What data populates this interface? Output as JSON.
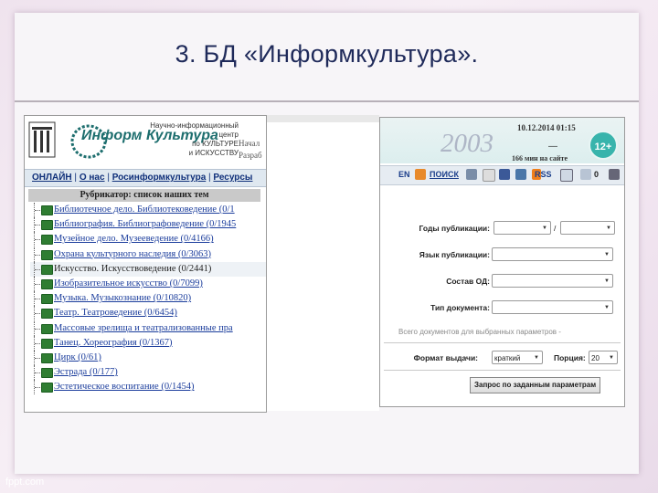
{
  "slide": {
    "title": "3. БД  «Информкультура».",
    "watermark": "fppt.com"
  },
  "site1": {
    "logo_text": "Информ Культура",
    "center_lines": [
      "Научно-информационный",
      "центр",
      "по КУЛЬТУРЕ",
      "и ИСКУССТВУ"
    ],
    "side_lines": [
      "Начал",
      "Разраб"
    ],
    "nav": [
      {
        "label": "ОНЛАЙН"
      },
      {
        "label": "О нас"
      },
      {
        "label": "Росинформкультура"
      },
      {
        "label": "Ресурсы"
      }
    ],
    "rubricator_title": "Рубрикатор: список наших тем",
    "items": [
      {
        "label": "Библиотечное дело. Библиотековедение (0/1"
      },
      {
        "label": "Библиография. Библиографоведение (0/1945"
      },
      {
        "label": "Музейное дело. Музееведение (0/4166)"
      },
      {
        "label": "Охрана культурного наследия (0/3063)"
      },
      {
        "label": "Искусство. Искусствоведение (0/2441)"
      },
      {
        "label": "Изобразительное искусство (0/7099)"
      },
      {
        "label": "Музыка. Музыкознание (0/10820)"
      },
      {
        "label": "Театр. Театроведение (0/6454)"
      },
      {
        "label": "Массовые зрелища и театрализованные пра"
      },
      {
        "label": "Танец. Хореография (0/1367)"
      },
      {
        "label": "Цирк (0/61)"
      },
      {
        "label": "Эстрада (0/177)"
      },
      {
        "label": "Эстетическое воспитание (0/1454)"
      }
    ]
  },
  "site2": {
    "year": "2003",
    "datetime": "10.12.2014 01:15",
    "dash": "—",
    "online_text": "166 мин на сайте",
    "age_badge": "12+",
    "toolbar": {
      "lang": "EN",
      "search": "ПОИСК",
      "rss": "RSS",
      "count": "0"
    },
    "form": {
      "years_label": "Годы публикации:",
      "years_slash": "/",
      "lang_label": "Язык публикации:",
      "composition_label": "Состав ОД:",
      "doctype_label": "Тип документа:",
      "total_text": "Всего документов для выбранных параметров -",
      "format_label": "Формат выдачи:",
      "format_value": "краткий",
      "portion_label": "Порция:",
      "portion_value": "20",
      "submit_label": "Запрос по заданным параметрам"
    }
  },
  "colors": {
    "title": "#1f2a5a",
    "link": "#1b3d9c",
    "badge": "#38b4ac",
    "book": "#2f7d32"
  }
}
